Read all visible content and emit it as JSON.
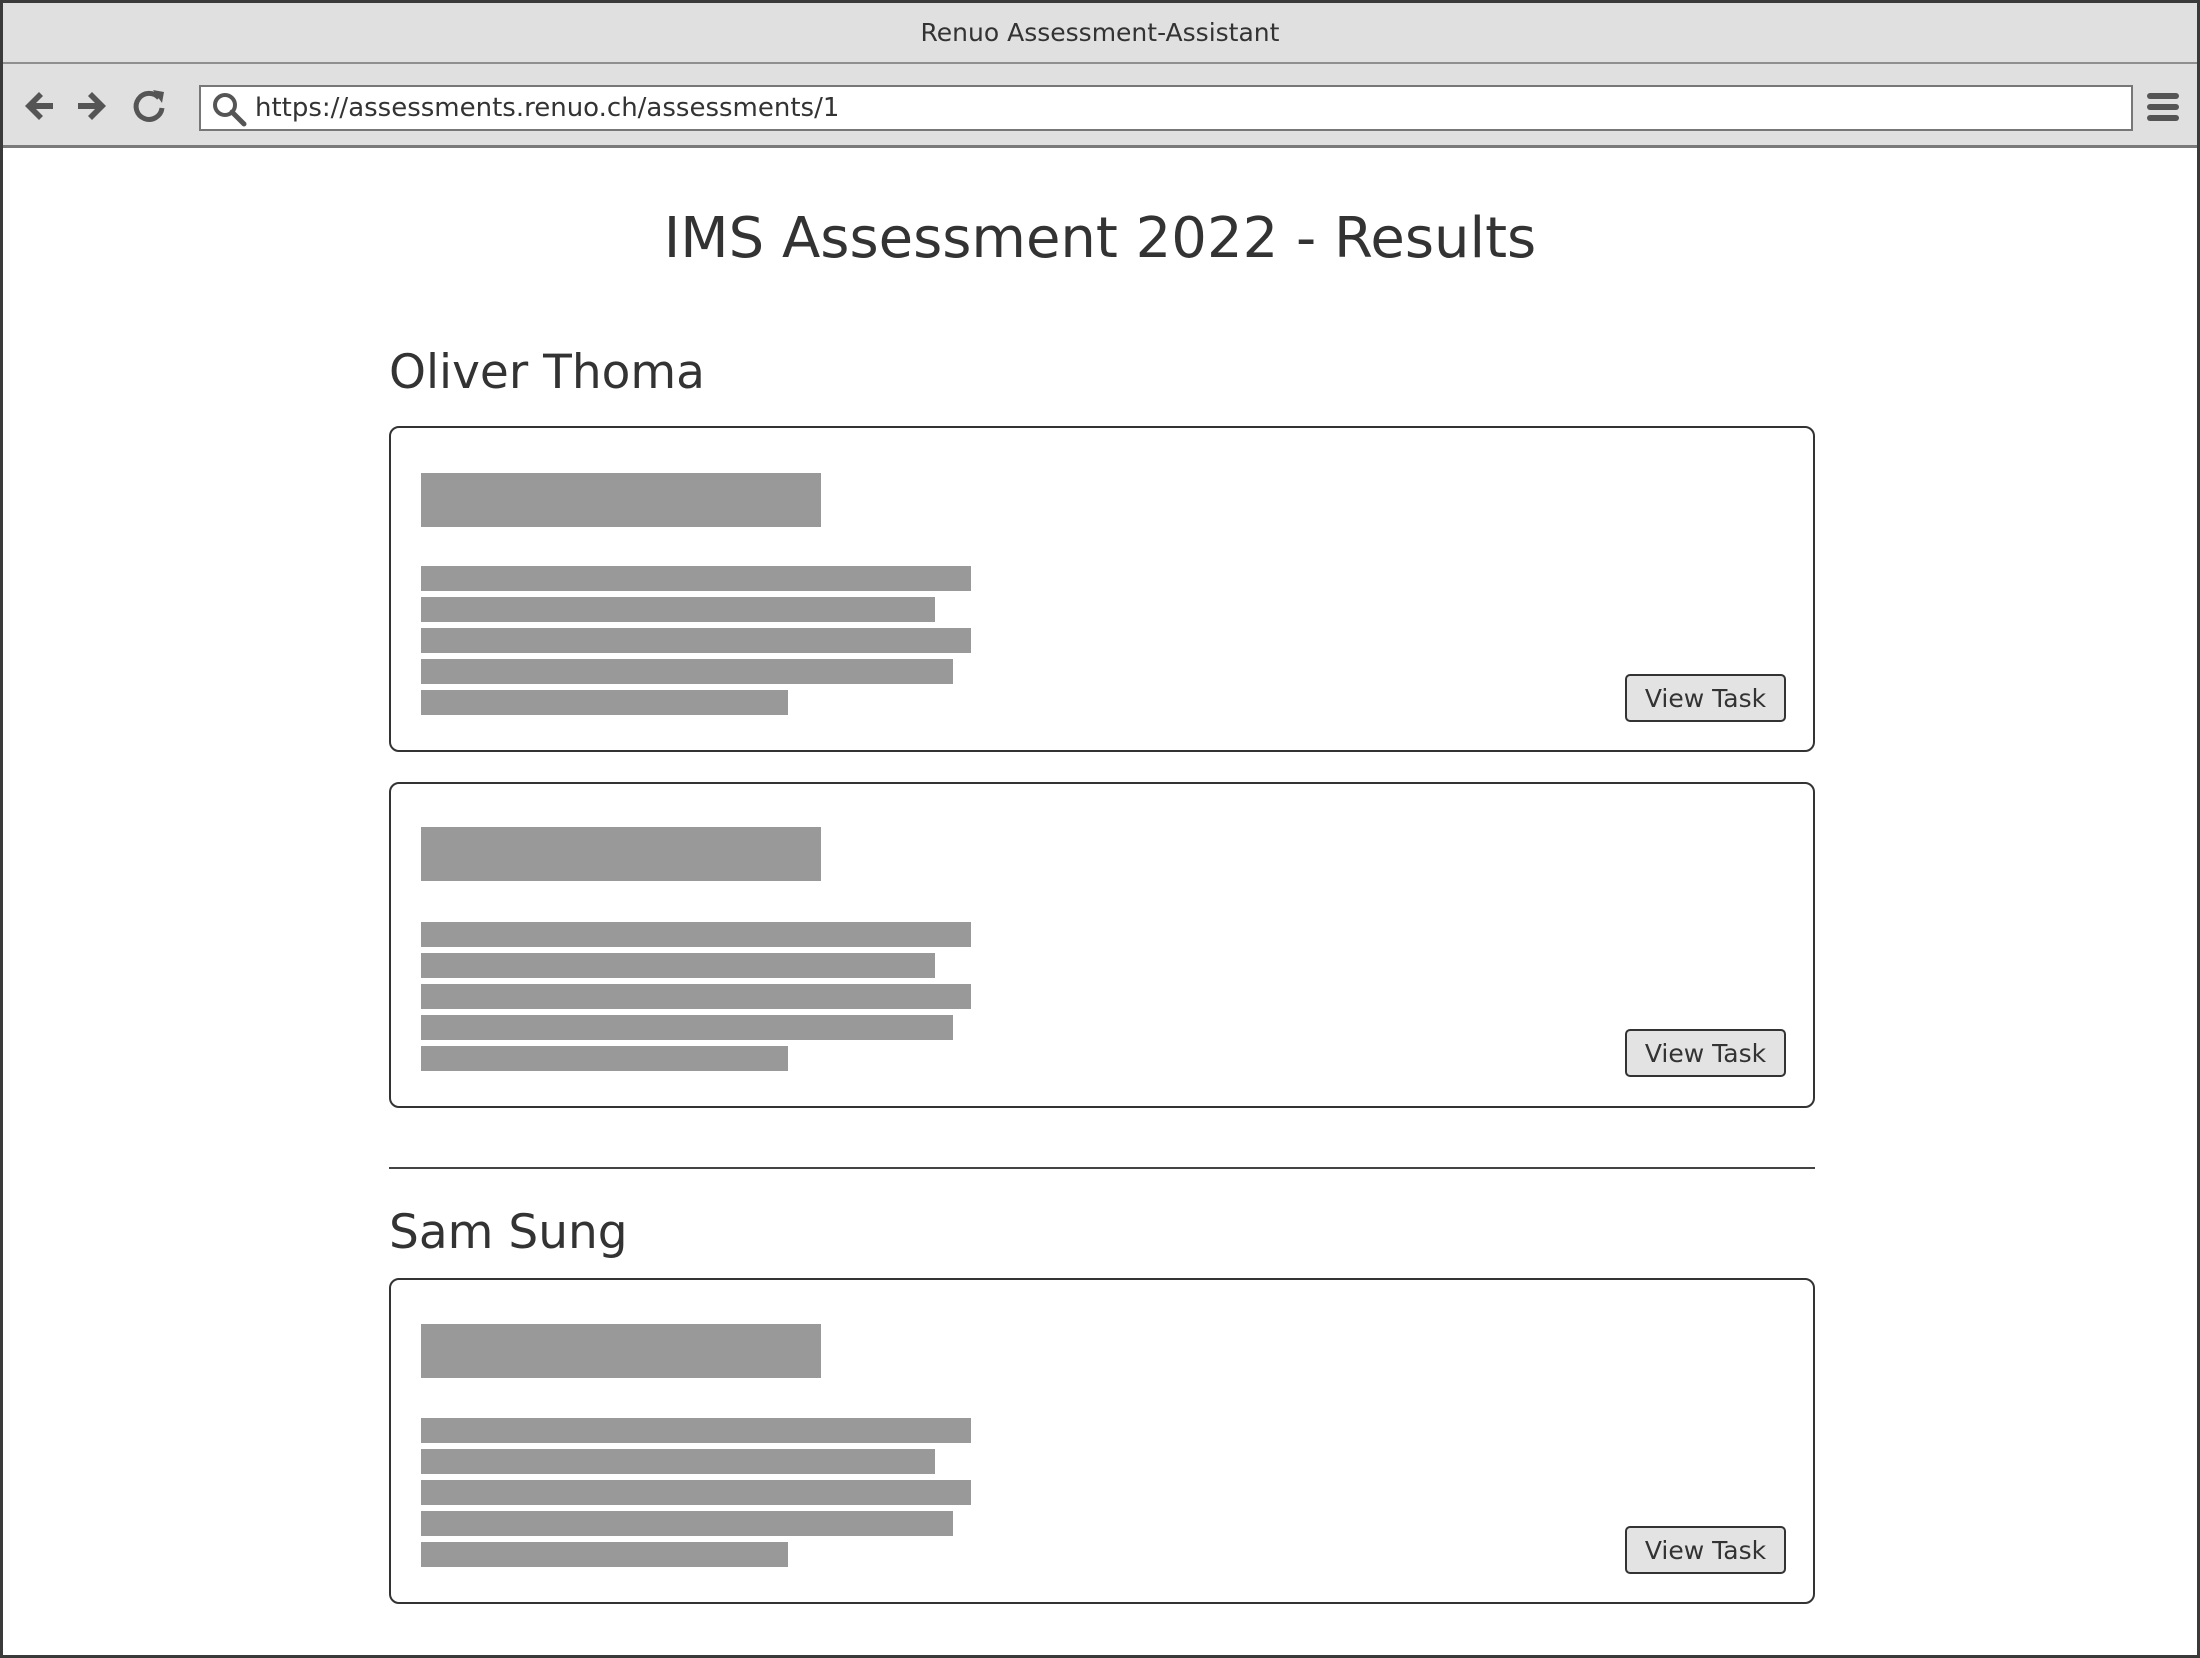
{
  "window": {
    "title": "Renuo Assessment-Assistant"
  },
  "toolbar": {
    "back_icon": "back-arrow-icon",
    "forward_icon": "forward-arrow-icon",
    "reload_icon": "reload-icon",
    "search_icon": "search-icon",
    "menu_icon": "hamburger-menu-icon",
    "url": "https://assessments.renuo.ch/assessments/1"
  },
  "page": {
    "title": "IMS Assessment 2022 - Results"
  },
  "candidates": [
    {
      "name": "Oliver Thoma",
      "tasks": [
        {
          "button_label": "View Task"
        },
        {
          "button_label": "View Task"
        }
      ]
    },
    {
      "name": "Sam Sung",
      "tasks": [
        {
          "button_label": "View Task"
        }
      ]
    }
  ],
  "colors": {
    "chrome_background": "#e0e0e0",
    "placeholder_block": "#999999",
    "button_background": "#e3e3e3",
    "text": "#333333"
  }
}
